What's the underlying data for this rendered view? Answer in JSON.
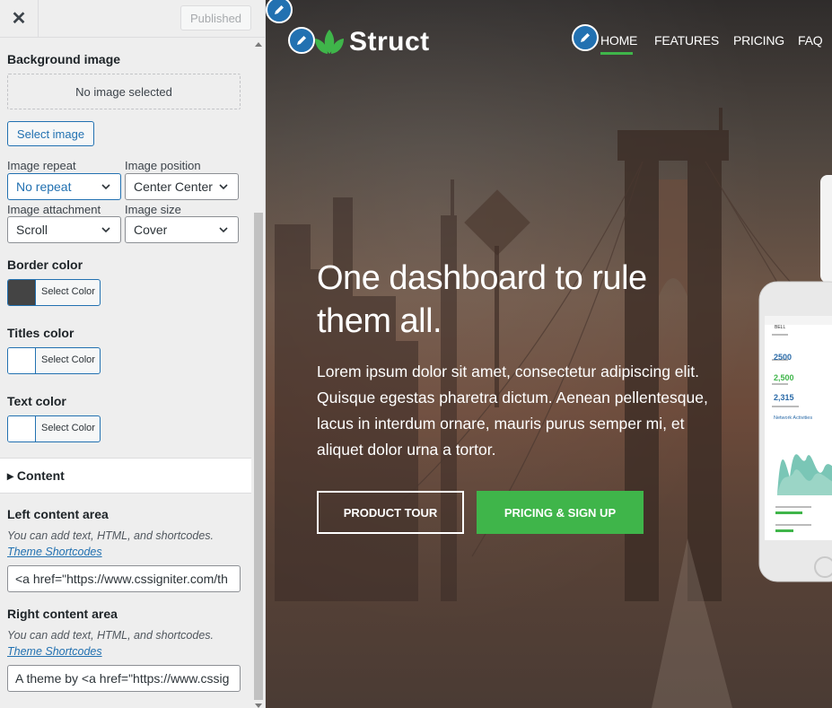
{
  "topbar": {
    "close_glyph": "✕",
    "published_label": "Published"
  },
  "panel": {
    "background_image_label": "Background image",
    "no_image_text": "No image selected",
    "select_image_label": "Select image",
    "image_repeat": {
      "label": "Image repeat",
      "value": "No repeat"
    },
    "image_position": {
      "label": "Image position",
      "value": "Center Center"
    },
    "image_attachment": {
      "label": "Image attachment",
      "value": "Scroll"
    },
    "image_size": {
      "label": "Image size",
      "value": "Cover"
    },
    "border_color": {
      "label": "Border color",
      "button": "Select Color",
      "swatch": "#444444"
    },
    "titles_color": {
      "label": "Titles color",
      "button": "Select Color",
      "swatch": "#ffffff"
    },
    "text_color": {
      "label": "Text color",
      "button": "Select Color",
      "swatch": "#ffffff"
    },
    "content_heading": "▸ Content",
    "left_content": {
      "label": "Left content area",
      "desc": "You can add text, HTML, and shortcodes.",
      "link": "Theme Shortcodes",
      "value": "<a href=\"https://www.cssigniter.com/th"
    },
    "right_content": {
      "label": "Right content area",
      "desc": "You can add text, HTML, and shortcodes.",
      "link": "Theme Shortcodes",
      "value": "A theme by <a href=\"https://www.cssig"
    }
  },
  "preview": {
    "brand": "Struct",
    "nav": [
      "HOME",
      "FEATURES",
      "PRICING",
      "FAQ"
    ],
    "hero_title": "One dashboard to rule them all.",
    "hero_text": "Lorem ipsum dolor sit amet, consectetur adipiscing elit. Quisque egestas pharetra dictum. Aenean pellentesque, lacus in interdum ornare, mauris purus semper mi, et aliquet dolor urna a tortor.",
    "btn_tour": "PRODUCT TOUR",
    "btn_pricing": "PRICING & SIGN UP",
    "phone": {
      "status": "BELL",
      "stats": [
        "2500",
        "2,500",
        "2,315"
      ],
      "chart_title": "Network Activities"
    }
  },
  "colors": {
    "accent": "#3fb54a",
    "wp_blue": "#2271b1"
  }
}
